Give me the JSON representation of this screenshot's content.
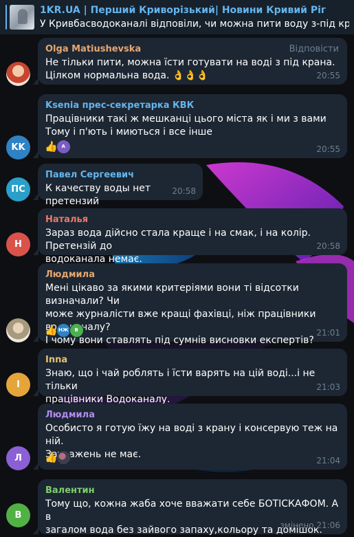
{
  "colors": {
    "chat_bg": "#0e0f13",
    "bubble_bg": "#1d2733",
    "header_bg": "#17212b",
    "accent": "#64b5ef",
    "meta": "#6d7f8f"
  },
  "header": {
    "channel_title": "1KR.UA | Перший Криворізький| Новини Кривий Ріг",
    "post_preview": "У Кривбасводоканалі відповіли, чи можна пити воду з-під крана Чита"
  },
  "messages": [
    {
      "author": "Olga Matiushevska",
      "name_color": "#e6a76f",
      "avatar": {
        "type": "photo",
        "icon": "person-photo"
      },
      "reply_label": "Відповісти",
      "text": "Не тільки пити, можна їсти готувати на воді з під крана.\nЦілком нормальна вода. 👌👌👌",
      "time": "20:55"
    },
    {
      "author": "Ksenia прес-секретарка КВК",
      "name_color": "#64b5ef",
      "avatar": {
        "type": "initials",
        "initials": "KK",
        "color": "#2f82c4"
      },
      "text": "Працівники такі ж мешканці цього міста як і ми з вами\nТому і п'ють і миються і все інше",
      "reactions": {
        "emoji": "👍",
        "count": "",
        "avatars": [
          {
            "initials": "А",
            "color": "#7a5cc4"
          }
        ]
      },
      "time": "20:55"
    },
    {
      "author": "Павел Сергеевич",
      "name_color": "#64b5ef",
      "avatar": {
        "type": "initials",
        "initials": "ПС",
        "color": "#2a9fc9"
      },
      "text": "К качеству воды нет претензий",
      "time": "20:58"
    },
    {
      "author": "Наталья",
      "name_color": "#e87a6e",
      "avatar": {
        "type": "initials",
        "initials": "Н",
        "color": "#d9534b"
      },
      "text": "Зараз вода дійсно стала краще і на смак, і на колір. Претензій до\nводоканала немає.",
      "time": "20:58"
    },
    {
      "author": "Людмила",
      "name_color": "#e6a76f",
      "avatar": {
        "type": "photo",
        "icon": "person-photo"
      },
      "text": "Мені цікаво за якими критеріями вони ті відсотки визначали? Чи\nможе журналісти вже кращі фахівці, ніж працівники водоканалу?\nІ чому вони ставлять під сумнів висновки експертів?",
      "reactions": {
        "emoji": "👍",
        "count": "",
        "avatars": [
          {
            "initials": "НЖ",
            "color": "#2f82c4"
          },
          {
            "initials": "В",
            "color": "#4caf50"
          }
        ]
      },
      "time": "21:01"
    },
    {
      "author": "Inna",
      "name_color": "#e6c36f",
      "avatar": {
        "type": "initials",
        "initials": "I",
        "color": "#e6a53a"
      },
      "text": "Знаю, що і чай роблять і їсти варять на цій воді...і не тільки\nпрацівники Водоканалу.",
      "time": "21:03"
    },
    {
      "author": "Людмила",
      "name_color": "#b28bf0",
      "avatar": {
        "type": "initials",
        "initials": "Л",
        "color": "#8b5fd6"
      },
      "text": "Особисто я готую їжу на воді з крану і консервую теж на ній.\nЗауважень не має.",
      "reactions": {
        "emoji": "👍",
        "count": "",
        "avatars": [
          {
            "initials": "",
            "color": "#3e3f4d",
            "photo": true
          }
        ]
      },
      "time": "21:04"
    },
    {
      "author": "Валентин",
      "name_color": "#7ecf6c",
      "avatar": {
        "type": "initials",
        "initials": "В",
        "color": "#52b145"
      },
      "text": "Тому що, кожна жаба хоче вважати себе БОТІСКАФОМ. А в\nзагалом вода без зайвого запаху,кольору та домішок.",
      "time": "змінено 21:06"
    }
  ]
}
